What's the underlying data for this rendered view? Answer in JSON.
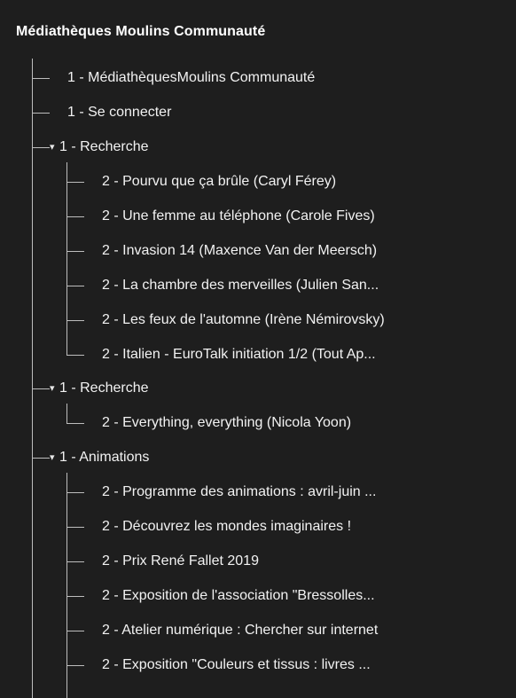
{
  "tree": {
    "root_title": "Médiathèques Moulins Communauté",
    "items": [
      "1 - MédiathèquesMoulins Communauté",
      "1 - Se connecter",
      "1 - Recherche",
      "2 - Pourvu que ça brûle (Caryl Férey)",
      "2 - Une femme au téléphone (Carole Fives)",
      "2 - Invasion 14 (Maxence Van der Meersch)",
      "2 - La chambre des merveilles (Julien San...",
      "2 - Les feux de l'automne (Irène Némirovsky)",
      "2 - Italien - EuroTalk initiation 1/2 (Tout Ap...",
      "1 - Recherche",
      "2 - Everything, everything (Nicola Yoon)",
      "1 - Animations",
      "2 - Programme des animations : avril-juin ...",
      "2 - Découvrez les mondes imaginaires !",
      "2 - Prix René Fallet 2019",
      "2 - Exposition de l'association \"Bressolles...",
      "2 - Atelier numérique : Chercher sur internet",
      "2 - Exposition \"Couleurs et tissus : livres ..."
    ],
    "toggle_glyph": "▾"
  }
}
